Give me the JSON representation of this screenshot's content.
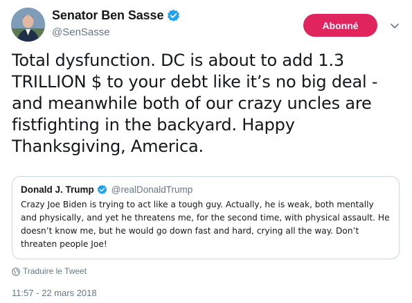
{
  "author": {
    "name": "Senator Ben Sasse",
    "handle": "@SenSasse",
    "verified_color": "#1da1f2"
  },
  "follow_button": {
    "label": "Abonné",
    "color": "#e0245e"
  },
  "menu": {
    "icon": "chevron-down-icon"
  },
  "tweet": {
    "text": "Total dysfunction. DC is about to add 1.3\nTRILLION $ to your debt like it’s no big deal -\nand meanwhile both of our crazy uncles are\nfistfighting in the backyard. Happy\nThanksgiving, America."
  },
  "quoted_tweet": {
    "name": "Donald J. Trump",
    "handle": "@realDonaldTrump",
    "text": "Crazy Joe Biden is trying to act like a tough guy. Actually, he is weak, both mentally\nand physically, and yet he threatens me, for the second time, with physical assault. He\ndoesn’t know me, but he would go down fast and hard, crying all the way. Don’t\nthreaten people Joe!"
  },
  "translate": {
    "label": "Traduire le Tweet",
    "icon": "globe-icon"
  },
  "timestamp": "11:57 - 22 mars 2018"
}
